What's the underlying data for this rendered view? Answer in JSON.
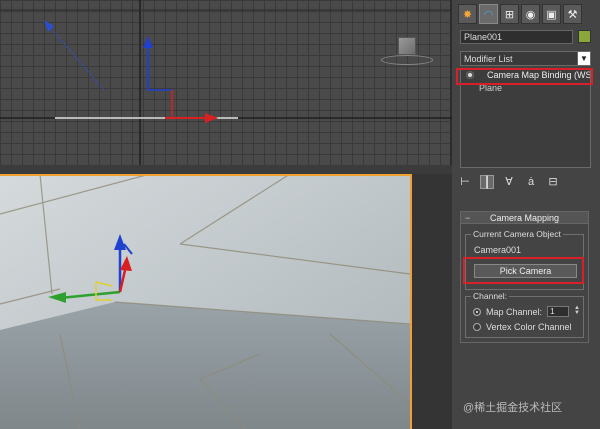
{
  "panel": {
    "tabs": [
      {
        "name": "create",
        "glyph": "✸"
      },
      {
        "name": "modify",
        "glyph": "◠"
      },
      {
        "name": "hierarchy",
        "glyph": "⊞"
      },
      {
        "name": "motion",
        "glyph": "◉"
      },
      {
        "name": "display",
        "glyph": "▣"
      },
      {
        "name": "utilities",
        "glyph": "⚒"
      }
    ],
    "object_name": "Plane001",
    "object_color": "#8aa83a",
    "modifier_list_label": "Modifier List",
    "stack": [
      {
        "label": "Camera Map Binding (WS",
        "active": true
      },
      {
        "label": "Plane",
        "active": false
      }
    ],
    "tool_icons": [
      "pin-stack-icon",
      "show-end-result-icon",
      "make-unique-icon",
      "remove-modifier-icon",
      "configure-sets-icon"
    ]
  },
  "rollout": {
    "title": "Camera Mapping",
    "camera_group_label": "Current Camera Object",
    "camera_name": "Camera001",
    "pick_button_label": "Pick Camera",
    "channel_group_label": "Channel:",
    "map_channel_label": "Map Channel:",
    "map_channel_value": "1",
    "vertex_color_label": "Vertex Color Channel",
    "map_channel_selected": true
  },
  "watermark": "@稀土掘金技术社区",
  "colors": {
    "highlight": "#d8202a",
    "viewport_active_border": "#f0a030",
    "gizmo_x": "#d82020",
    "gizmo_y": "#2ea02e",
    "gizmo_z": "#2040d0"
  }
}
